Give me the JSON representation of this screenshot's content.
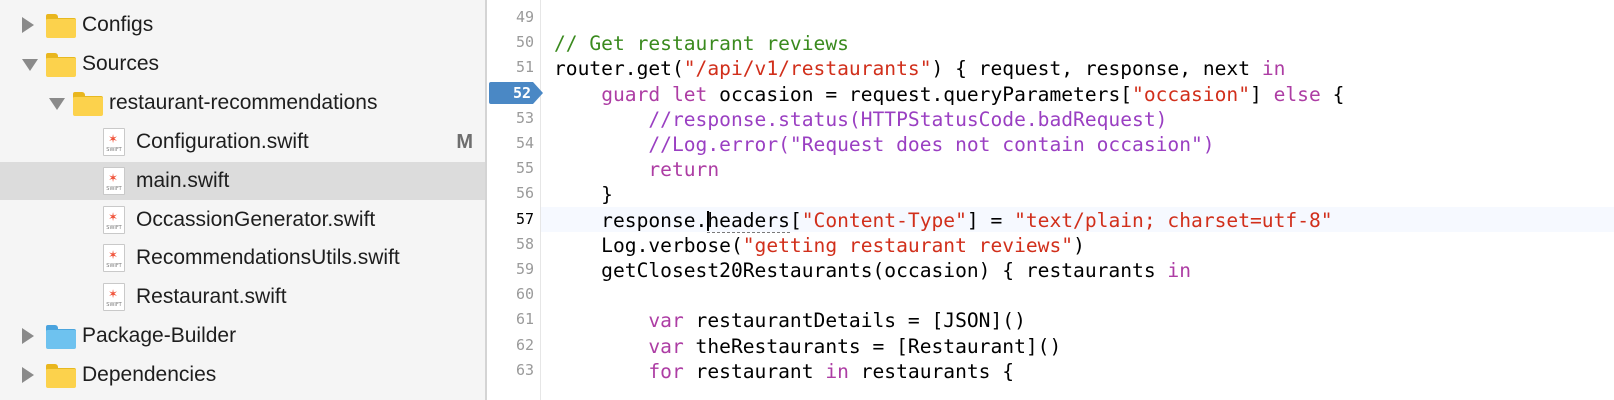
{
  "navigator": {
    "items": [
      {
        "label": "Configs",
        "kind": "folder",
        "color": "yellow",
        "disclosure": "closed",
        "level": 0
      },
      {
        "label": "Sources",
        "kind": "folder",
        "color": "yellow",
        "disclosure": "open",
        "level": 0
      },
      {
        "label": "restaurant-recommendations",
        "kind": "folder",
        "color": "yellow",
        "disclosure": "open",
        "level": 1
      },
      {
        "label": "Configuration.swift",
        "kind": "file",
        "level": 2,
        "badge": "M"
      },
      {
        "label": "main.swift",
        "kind": "file",
        "level": 2,
        "selected": true
      },
      {
        "label": "OccassionGenerator.swift",
        "kind": "file",
        "level": 2
      },
      {
        "label": "RecommendationsUtils.swift",
        "kind": "file",
        "level": 2
      },
      {
        "label": "Restaurant.swift",
        "kind": "file",
        "level": 2
      },
      {
        "label": "Package-Builder",
        "kind": "folder",
        "color": "blue",
        "disclosure": "closed",
        "level": 0
      },
      {
        "label": "Dependencies",
        "kind": "folder",
        "color": "yellow",
        "disclosure": "closed",
        "level": 0
      }
    ],
    "file_icon_label": "SWIFT"
  },
  "editor": {
    "breakpoint_line": "52",
    "current_line": "57",
    "lines": [
      {
        "num": "49",
        "tokens": []
      },
      {
        "num": "50",
        "tokens": [
          {
            "t": "cm",
            "v": "// Get restaurant reviews"
          }
        ]
      },
      {
        "num": "51",
        "tokens": [
          {
            "t": "pl",
            "v": "router.get("
          },
          {
            "t": "str",
            "v": "\"/api/v1/restaurants\""
          },
          {
            "t": "pl",
            "v": ") { request, response, next "
          },
          {
            "t": "kw",
            "v": "in"
          }
        ]
      },
      {
        "num": "52",
        "tokens": [
          {
            "t": "pl",
            "v": "    "
          },
          {
            "t": "kw",
            "v": "guard let"
          },
          {
            "t": "pl",
            "v": " occasion = request.queryParameters["
          },
          {
            "t": "str",
            "v": "\"occasion\""
          },
          {
            "t": "pl",
            "v": "] "
          },
          {
            "t": "kw",
            "v": "else"
          },
          {
            "t": "pl",
            "v": " {"
          }
        ]
      },
      {
        "num": "53",
        "tokens": [
          {
            "t": "pl",
            "v": "        "
          },
          {
            "t": "dc",
            "v": "//response.status(HTTPStatusCode.badRequest)"
          }
        ]
      },
      {
        "num": "54",
        "tokens": [
          {
            "t": "pl",
            "v": "        "
          },
          {
            "t": "dc",
            "v": "//Log.error(\"Request does not contain occasion\")"
          }
        ]
      },
      {
        "num": "55",
        "tokens": [
          {
            "t": "pl",
            "v": "        "
          },
          {
            "t": "kw",
            "v": "return"
          }
        ]
      },
      {
        "num": "56",
        "tokens": [
          {
            "t": "pl",
            "v": "    }"
          }
        ]
      },
      {
        "num": "57",
        "tokens": [
          {
            "t": "pl",
            "v": "    response."
          },
          {
            "t": "caret",
            "v": ""
          },
          {
            "t": "ul",
            "v": "headers"
          },
          {
            "t": "pl",
            "v": "["
          },
          {
            "t": "str",
            "v": "\"Content-Type\""
          },
          {
            "t": "pl",
            "v": "] = "
          },
          {
            "t": "str",
            "v": "\"text/plain; charset=utf-8\""
          }
        ]
      },
      {
        "num": "58",
        "tokens": [
          {
            "t": "pl",
            "v": "    Log.verbose("
          },
          {
            "t": "str",
            "v": "\"getting restaurant reviews\""
          },
          {
            "t": "pl",
            "v": ")"
          }
        ]
      },
      {
        "num": "59",
        "tokens": [
          {
            "t": "pl",
            "v": "    getClosest20Restaurants(occasion) { restaurants "
          },
          {
            "t": "kw",
            "v": "in"
          }
        ]
      },
      {
        "num": "60",
        "tokens": []
      },
      {
        "num": "61",
        "tokens": [
          {
            "t": "pl",
            "v": "        "
          },
          {
            "t": "kw",
            "v": "var"
          },
          {
            "t": "pl",
            "v": " restaurantDetails = [JSON]()"
          }
        ]
      },
      {
        "num": "62",
        "tokens": [
          {
            "t": "pl",
            "v": "        "
          },
          {
            "t": "kw",
            "v": "var"
          },
          {
            "t": "pl",
            "v": " theRestaurants = [Restaurant]()"
          }
        ]
      },
      {
        "num": "63",
        "tokens": [
          {
            "t": "pl",
            "v": "        "
          },
          {
            "t": "kw",
            "v": "for"
          },
          {
            "t": "pl",
            "v": " restaurant "
          },
          {
            "t": "kw",
            "v": "in"
          },
          {
            "t": "pl",
            "v": " restaurants {"
          }
        ]
      }
    ]
  },
  "colors": {
    "keyword": "#ad3da4",
    "string": "#d12f1b",
    "comment": "#3a8a1e",
    "doc_comment": "#9a3fc2",
    "breakpoint": "#4a88c5",
    "selection": "#dcdcdc"
  }
}
